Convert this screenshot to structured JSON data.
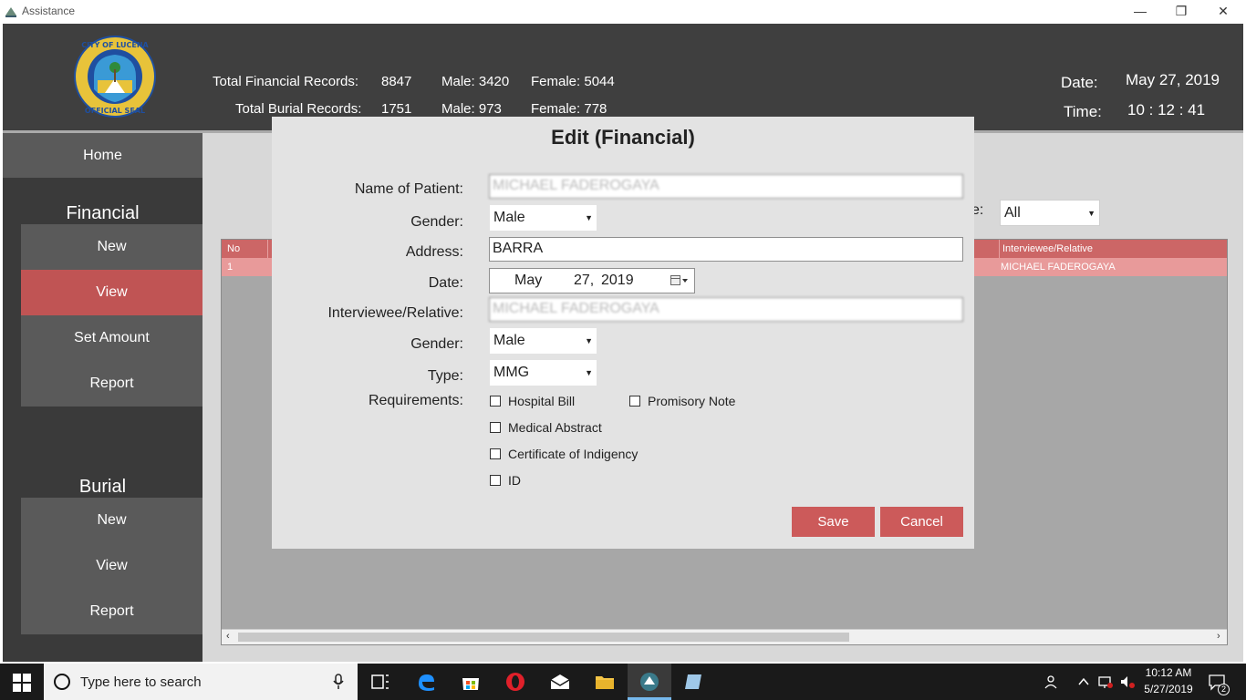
{
  "window": {
    "title": "Assistance",
    "minimize_glyph": "—",
    "restore_glyph": "❐",
    "close_glyph": "✕"
  },
  "header": {
    "seal_alt": "City of Lucena Official Seal",
    "seal_top_text": "CITY OF LUCENA",
    "seal_bottom_text": "OFFICIAL SEAL",
    "financial_label": "Total Financial Records:",
    "financial_total": "8847",
    "financial_male": "Male: 3420",
    "financial_female": "Female: 5044",
    "burial_label": "Total Burial Records:",
    "burial_total": "1751",
    "burial_male": "Male: 973",
    "burial_female": "Female: 778",
    "date_label": "Date:",
    "date_value": "May 27, 2019",
    "time_label": "Time:",
    "time_value": "10 : 12 : 41"
  },
  "sidebar": {
    "home": "Home",
    "financial_heading": "Financial",
    "financial_items": [
      "New",
      "View",
      "Set Amount",
      "Report"
    ],
    "burial_heading": "Burial",
    "burial_items": [
      "New",
      "View",
      "Report"
    ]
  },
  "view": {
    "type_label_partial": "e:",
    "type_filter": "All",
    "grid_columns": {
      "no": "No",
      "interviewee": "Interviewee/Relative"
    },
    "grid_rows": [
      {
        "no": "1",
        "interviewee": "MICHAEL FADEROGAYA"
      }
    ]
  },
  "dialog": {
    "title": "Edit (Financial)",
    "name_label": "Name of Patient:",
    "name_value": "MICHAEL FADEROGAYA",
    "gender_label": "Gender:",
    "gender_value": "Male",
    "address_label": "Address:",
    "address_value": "BARRA",
    "date_label": "Date:",
    "date_month": "May",
    "date_day": "27,",
    "date_year": "2019",
    "interviewee_label": "Interviewee/Relative:",
    "interviewee_value": "MICHAEL FADEROGAYA",
    "gender2_label": "Gender:",
    "gender2_value": "Male",
    "type_label": "Type:",
    "type_value": "MMG",
    "requirements_label": "Requirements:",
    "requirements": {
      "hospital_bill": "Hospital Bill",
      "promisory_note": "Promisory Note",
      "medical_abstract": "Medical Abstract",
      "certificate_indigency": "Certificate of Indigency",
      "id": "ID"
    },
    "save_label": "Save",
    "cancel_label": "Cancel"
  },
  "taskbar": {
    "search_placeholder": "Type here to search",
    "clock_time": "10:12 AM",
    "clock_date": "5/27/2019",
    "notification_count": "2"
  },
  "colors": {
    "accent": "#cc5a5a",
    "header_bg": "#3f3f3f",
    "sidebar_bg": "#3a3a3a",
    "sidebar_btn": "#5a5a5a"
  }
}
